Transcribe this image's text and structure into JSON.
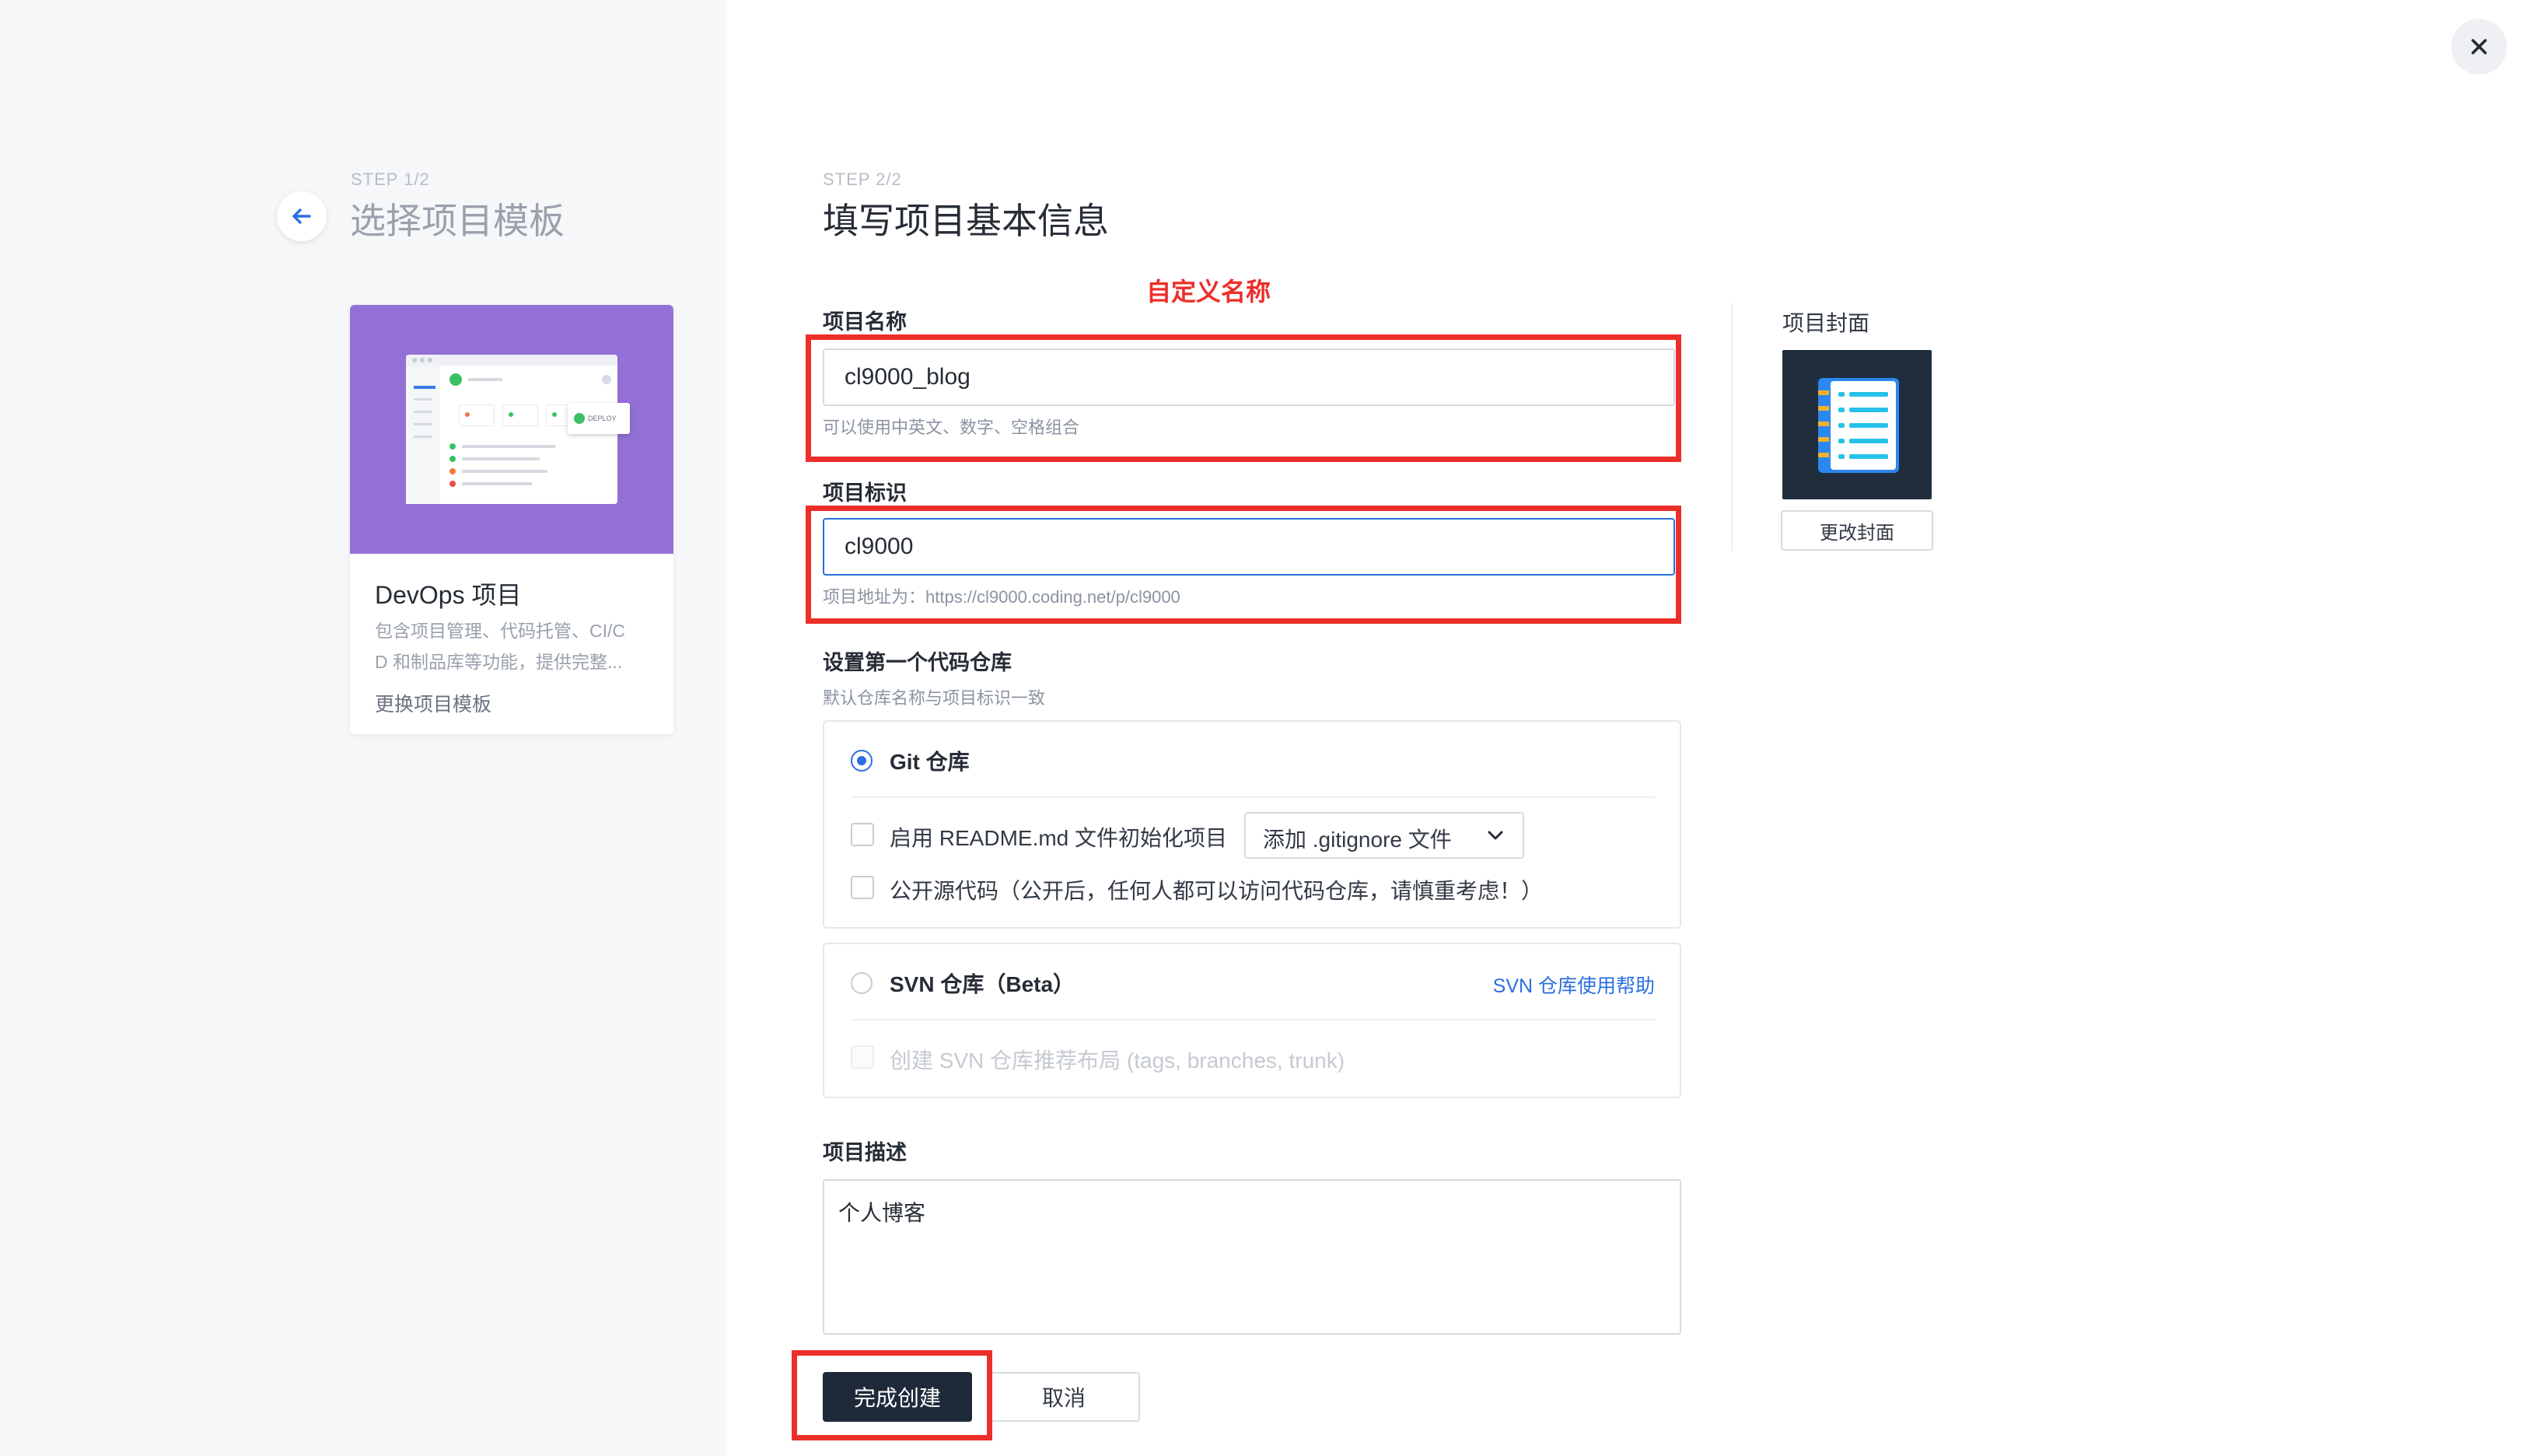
{
  "left": {
    "step": "STEP 1/2",
    "title": "选择项目模板",
    "card": {
      "hero_badge": "DEPLOY",
      "title": "DevOps 项目",
      "desc_line1": "包含项目管理、代码托管、CI/C",
      "desc_line2": "D 和制品库等功能，提供完整...",
      "change_link": "更换项目模板"
    }
  },
  "form": {
    "step": "STEP 2/2",
    "title": "填写项目基本信息",
    "annotation": "自定义名称",
    "name": {
      "label": "项目名称",
      "value": "cl9000_blog",
      "hint": "可以使用中英文、数字、空格组合"
    },
    "identifier": {
      "label": "项目标识",
      "value": "cl9000",
      "hint": "项目地址为：https://cl9000.coding.net/p/cl9000"
    },
    "repo": {
      "label": "设置第一个代码仓库",
      "hint": "默认仓库名称与项目标识一致",
      "git": {
        "label": "Git 仓库",
        "readme_label": "启用 README.md 文件初始化项目",
        "gitignore_select": "添加 .gitignore 文件",
        "public_label": "公开源代码（公开后，任何人都可以访问代码仓库，请慎重考虑！）"
      },
      "svn": {
        "label": "SVN 仓库（Beta）",
        "help_link": "SVN 仓库使用帮助",
        "layout_label": "创建 SVN 仓库推荐布局 (tags, branches, trunk)"
      }
    },
    "description": {
      "label": "项目描述",
      "value": "个人博客"
    },
    "submit": "完成创建",
    "cancel": "取消"
  },
  "cover": {
    "label": "项目封面",
    "change_button": "更改封面"
  },
  "close": "×",
  "colors": {
    "primary": "#2b6fe0",
    "annotation_red": "#ec2f2a",
    "hero_purple": "#9370d6",
    "dark_button": "#1e2a3a"
  }
}
